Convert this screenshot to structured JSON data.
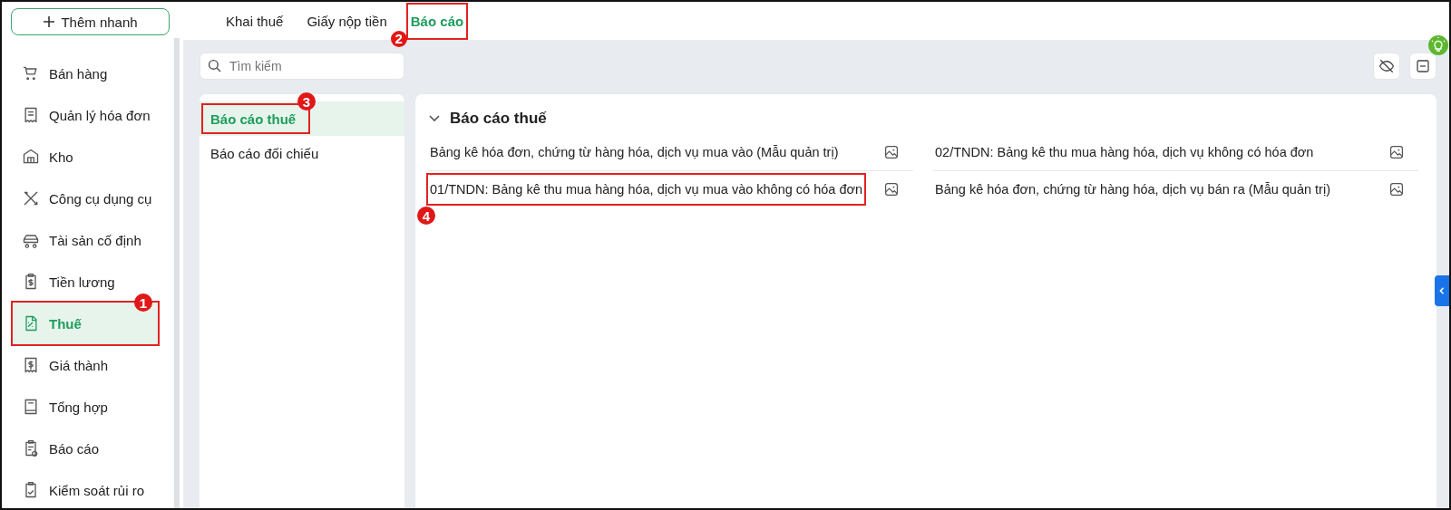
{
  "quick_add": {
    "label": "Thêm nhanh"
  },
  "sidebar": {
    "items": [
      {
        "label": "Bán hàng",
        "selected": false
      },
      {
        "label": "Quản lý hóa đơn",
        "selected": false
      },
      {
        "label": "Kho",
        "selected": false
      },
      {
        "label": "Công cụ dụng cụ",
        "selected": false
      },
      {
        "label": "Tài sản cố định",
        "selected": false
      },
      {
        "label": "Tiền lương",
        "selected": false
      },
      {
        "label": "Thuế",
        "selected": true,
        "callout": "1"
      },
      {
        "label": "Giá thành",
        "selected": false
      },
      {
        "label": "Tổng hợp",
        "selected": false
      },
      {
        "label": "Báo cáo",
        "selected": false
      },
      {
        "label": "Kiểm soát rủi ro",
        "selected": false
      }
    ]
  },
  "tabs": [
    {
      "label": "Khai thuế",
      "selected": false
    },
    {
      "label": "Giấy nộp tiền",
      "selected": false
    },
    {
      "label": "Báo cáo",
      "selected": true,
      "callout": "2"
    }
  ],
  "search": {
    "placeholder": "Tìm kiếm"
  },
  "categories": [
    {
      "label": "Báo cáo thuế",
      "selected": true,
      "callout": "3"
    },
    {
      "label": "Báo cáo đối chiếu",
      "selected": false
    }
  ],
  "section": {
    "title": "Báo cáo thuế",
    "expanded": true,
    "reports": [
      {
        "label": "Bảng kê hóa đơn, chứng từ hàng hóa, dịch vụ mua vào (Mẫu quản trị)"
      },
      {
        "label": "02/TNDN: Bảng kê thu mua hàng hóa, dịch vụ không có hóa đơn"
      },
      {
        "label": "01/TNDN: Bảng kê thu mua hàng hóa, dịch vụ mua vào không có hóa đơn",
        "callout": "4"
      },
      {
        "label": "Bảng kê hóa đơn, chứng từ hàng hóa, dịch vụ bán ra (Mẫu quản trị)"
      }
    ]
  }
}
